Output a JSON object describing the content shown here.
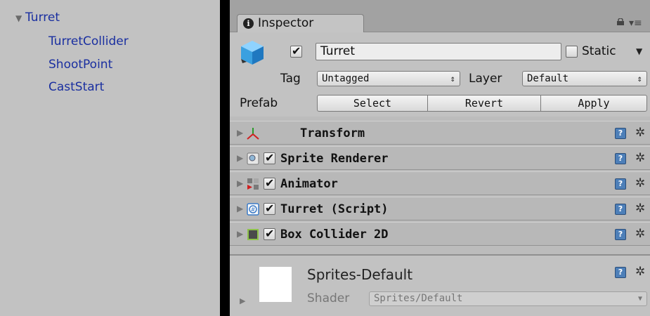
{
  "hierarchy": {
    "root": {
      "arrow": "▼",
      "label": "Turret"
    },
    "children": [
      "TurretCollider",
      "ShootPoint",
      "CastStart"
    ]
  },
  "inspector": {
    "tab_label": "Inspector",
    "game_object": {
      "active": true,
      "name": "Turret",
      "static": false,
      "static_label": "Static",
      "tag_label": "Tag",
      "tag_value": "Untagged",
      "layer_label": "Layer",
      "layer_value": "Default",
      "prefab_label": "Prefab",
      "prefab_buttons": {
        "select": "Select",
        "revert": "Revert",
        "apply": "Apply"
      }
    },
    "components": [
      {
        "title": "Transform",
        "icon": "transform-axes-icon",
        "has_checkbox": false
      },
      {
        "title": "Sprite Renderer",
        "icon": "sprite-renderer-icon",
        "has_checkbox": true,
        "enabled": true
      },
      {
        "title": "Animator",
        "icon": "animator-icon",
        "has_checkbox": true,
        "enabled": true
      },
      {
        "title": "Turret (Script)",
        "icon": "csharp-script-icon",
        "has_checkbox": true,
        "enabled": true
      },
      {
        "title": "Box Collider 2D",
        "icon": "box-collider-2d-icon",
        "has_checkbox": true,
        "enabled": true
      }
    ],
    "material": {
      "name": "Sprites-Default",
      "shader_label": "Shader",
      "shader_value": "Sprites/Default"
    }
  },
  "colors": {
    "hierarchy_text": "#1a2fa0",
    "panel_bg": "#c2c2c2",
    "help_icon": "#4d7fb8",
    "collider_green": "#8ec24a"
  }
}
